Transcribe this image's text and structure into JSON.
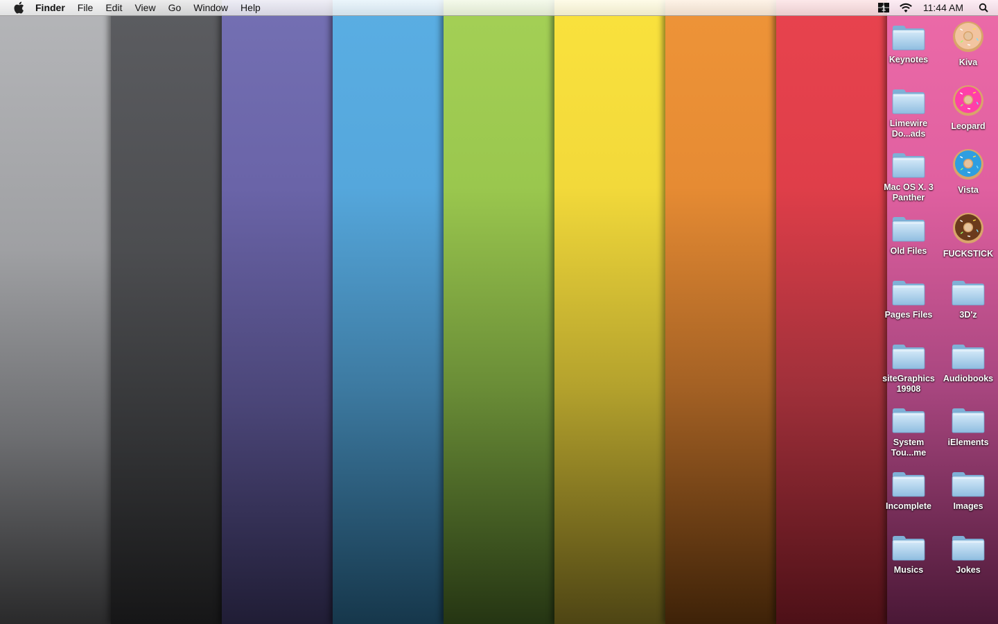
{
  "menubar": {
    "app_name": "Finder",
    "menus": [
      "File",
      "Edit",
      "View",
      "Go",
      "Window",
      "Help"
    ],
    "clock": "11:44 AM",
    "status_icons": [
      "spaces-icon",
      "wifi-icon",
      "spotlight-icon"
    ],
    "spaces_number": "1"
  },
  "wallpaper": {
    "stripe_colors": [
      "#b5b6b9",
      "#5c5d61",
      "#7470b3",
      "#5aaee3",
      "#a4d056",
      "#fae23d",
      "#ee9438",
      "#e8434e",
      "#ec6aa8"
    ]
  },
  "desktop": {
    "icons": [
      {
        "label": "Keynotes",
        "type": "folder"
      },
      {
        "label": "Kiva",
        "type": "donut",
        "color": "#f2c4a0"
      },
      {
        "label": "Limewire Do...ads",
        "type": "folder"
      },
      {
        "label": "Leopard",
        "type": "donut",
        "color": "#ff3fa8"
      },
      {
        "label": "Mac OS X. 3 Panther",
        "type": "folder"
      },
      {
        "label": "Vista",
        "type": "donut",
        "color": "#2f9ee0"
      },
      {
        "label": "Old Files",
        "type": "folder"
      },
      {
        "label": "FUCKSTICK",
        "type": "donut",
        "color": "#6b3a1c"
      },
      {
        "label": "Pages Files",
        "type": "folder"
      },
      {
        "label": "3D'z",
        "type": "folder"
      },
      {
        "label": "siteGraphics19908",
        "type": "folder"
      },
      {
        "label": "Audiobooks",
        "type": "folder"
      },
      {
        "label": "System Tou...me",
        "type": "folder"
      },
      {
        "label": "iElements",
        "type": "folder"
      },
      {
        "label": "Incomplete",
        "type": "folder"
      },
      {
        "label": "Images",
        "type": "folder"
      },
      {
        "label": "Musics",
        "type": "folder"
      },
      {
        "label": "Jokes",
        "type": "folder"
      }
    ]
  }
}
